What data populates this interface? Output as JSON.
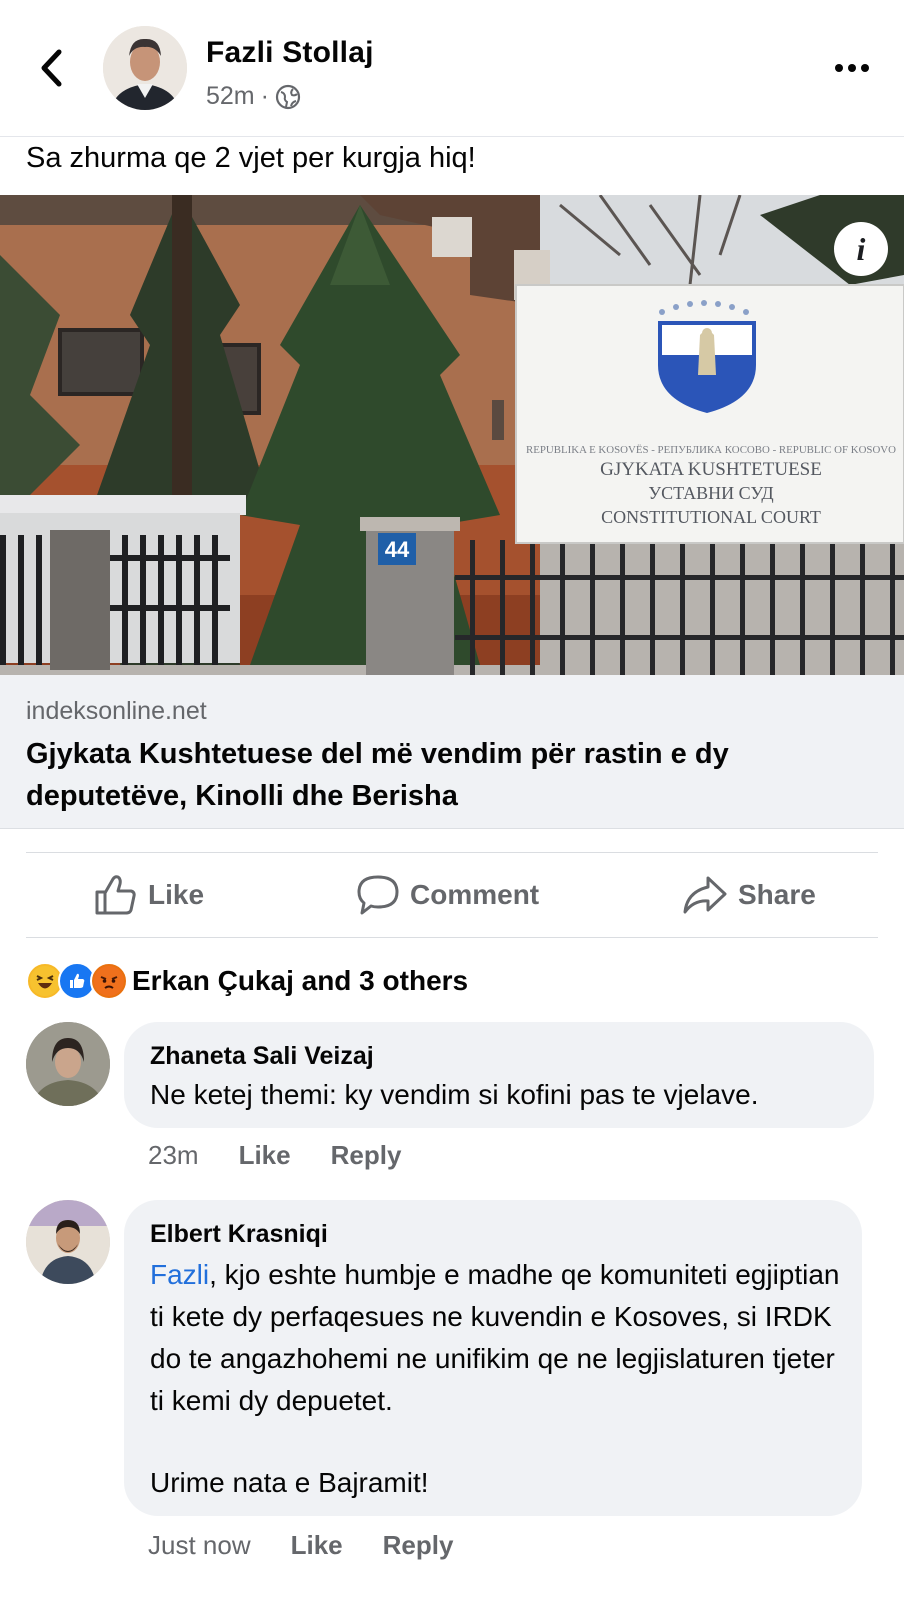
{
  "post": {
    "author": "Fazli Stollaj",
    "time": "52m",
    "separator": "·",
    "caption": "Sa zhurma qe 2 vjet per kurgja hiq!",
    "icons": {
      "back": "chevron-left-icon",
      "privacy": "globe-icon",
      "more": "more-icon"
    }
  },
  "photo": {
    "info_label": "i",
    "sign_line1": "REPUBLIKA E KOSOVËS - РЕПУБЛИКА КОСОВО - REPUBLIC OF KOSOVO",
    "sign_line2": "GJYKATA KUSHTETUESE",
    "sign_line3": "УСТАВНИ СУД",
    "sign_line4": "CONSTITUTIONAL COURT",
    "house_number": "44"
  },
  "link": {
    "domain": "indeksonline.net",
    "title": "Gjykata Kushtetuese del më vendim për rastin e dy deputetëve, Kinolli dhe Berisha"
  },
  "actions": {
    "like": "Like",
    "comment": "Comment",
    "share": "Share"
  },
  "reactions": {
    "text": "Erkan Çukaj and 3 others",
    "types": [
      "haha",
      "like",
      "angry"
    ]
  },
  "comments": [
    {
      "name": "Zhaneta Sali Veizaj",
      "text": "Ne ketej themi: ky vendim si kofini pas te vjelave.",
      "time": "23m",
      "like": "Like",
      "reply": "Reply"
    },
    {
      "name": "Elbert Krasniqi",
      "mention": "Fazli",
      "text": ", kjo eshte humbje e madhe qe komuniteti egjiptian ti kete dy perfaqesues ne kuvendin e Kosoves, si IRDK do te angazhohemi ne unifikim qe ne legjislaturen tjeter ti kemi dy depuetet.",
      "text2": "Urime nata e Bajramit!",
      "time": "Just now",
      "like": "Like",
      "reply": "Reply"
    }
  ],
  "colors": {
    "link_blue": "#216fdb",
    "muted": "#65676b",
    "bubble": "#f0f2f5",
    "like_blue": "#1877f2"
  }
}
